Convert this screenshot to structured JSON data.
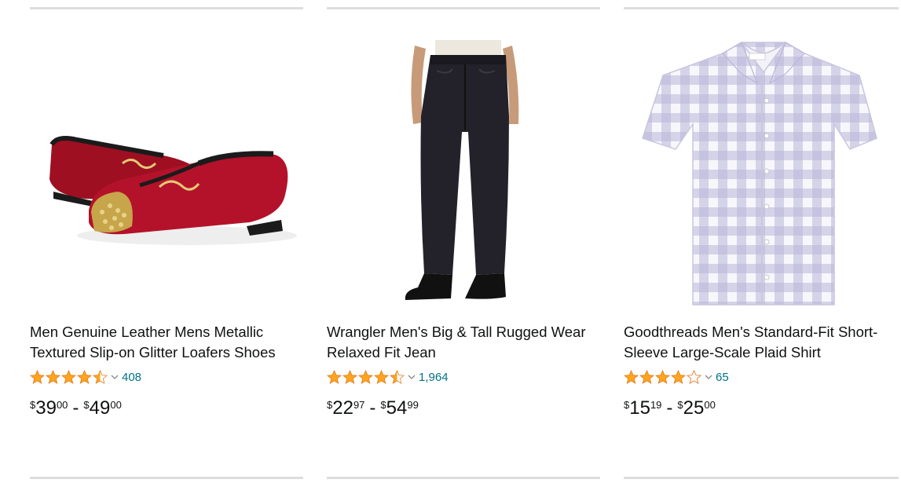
{
  "products": [
    {
      "title": "Men Genuine Leather Mens Metallic Textured Slip-on Glitter Loafers Shoes",
      "rating": 4.5,
      "review_count": "408",
      "price_low": {
        "symbol": "$",
        "whole": "39",
        "fraction": "00"
      },
      "price_high": {
        "symbol": "$",
        "whole": "49",
        "fraction": "00"
      },
      "dash": "-",
      "image": "red velvet loafer shoes with gold spiked toe"
    },
    {
      "title": "Wrangler Men's Big & Tall Rugged Wear Relaxed Fit Jean",
      "rating": 4.5,
      "review_count": "1,964",
      "price_low": {
        "symbol": "$",
        "whole": "22",
        "fraction": "97"
      },
      "price_high": {
        "symbol": "$",
        "whole": "54",
        "fraction": "99"
      },
      "dash": "-",
      "image": "black relaxed fit jeans with black boots"
    },
    {
      "title": "Goodthreads Men's Standard-Fit Short-Sleeve Large-Scale Plaid Shirt",
      "rating": 4.0,
      "review_count": "65",
      "price_low": {
        "symbol": "$",
        "whole": "15",
        "fraction": "19"
      },
      "price_high": {
        "symbol": "$",
        "whole": "25",
        "fraction": "00"
      },
      "dash": "-",
      "image": "lavender and white gingham short-sleeve shirt"
    }
  ],
  "colors": {
    "star": "#ffa41c",
    "link": "#007185",
    "divider": "#dddddd",
    "text": "#0f1111"
  },
  "icons": [
    "star-full-icon",
    "star-half-icon",
    "star-empty-icon",
    "chevron-down-icon"
  ]
}
